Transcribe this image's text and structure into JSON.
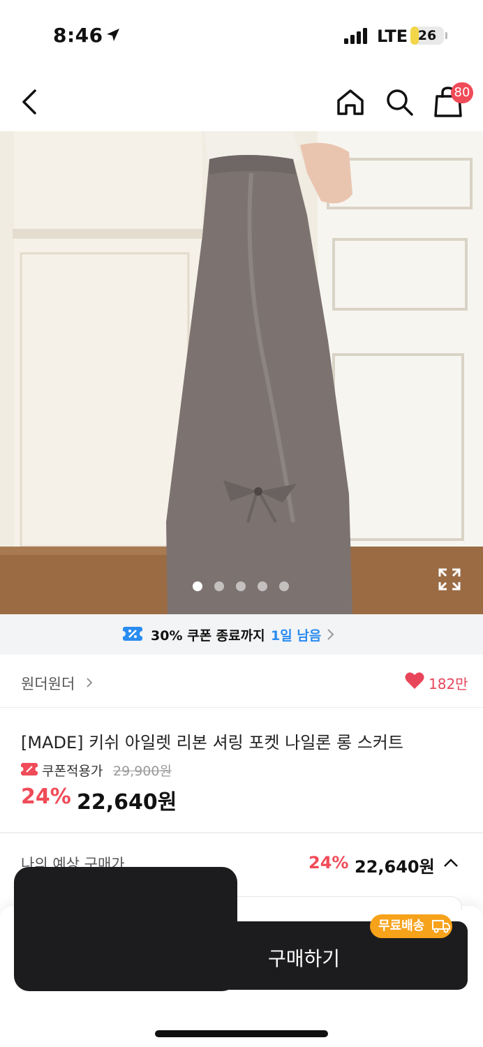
{
  "status_bar": {
    "time": "8:46",
    "network": "LTE",
    "battery": "26",
    "battery_level_pct": 26
  },
  "nav": {
    "cart_count": "80",
    "icons": [
      "back-icon",
      "home-icon",
      "search-icon",
      "shopping-bag-icon"
    ]
  },
  "gallery": {
    "image_count": 5,
    "active_index": 0
  },
  "coupon_banner": {
    "text": "30% 쿠폰 종료까지",
    "remaining": "1일 남음"
  },
  "brand": {
    "name": "원더원더",
    "likes": "182만"
  },
  "product": {
    "title": "[MADE] 키쉬 아일렛 리본 셔링 포켓 나일론 롱 스커트",
    "coupon_price_label": "쿠폰적용가",
    "original_price": "29,900원",
    "discount_rate": "24%",
    "sale_price": "22,640원"
  },
  "estimate": {
    "label": "나의 예상 구매가",
    "rate": "24%",
    "price": "22,640원"
  },
  "bottom_bar": {
    "buy_label": "구매하기",
    "free_shipping": "무료배송"
  },
  "colors": {
    "accent_red": "#f04b58",
    "link_blue": "#2a8cef",
    "shipping_orange": "#f7a21b",
    "button_dark": "#1c1c1e"
  }
}
